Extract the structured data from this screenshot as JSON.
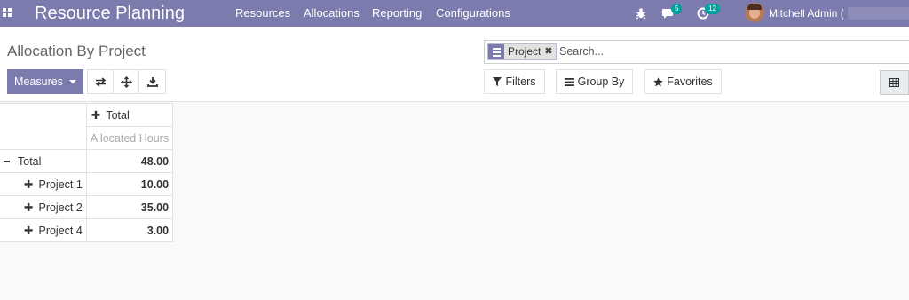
{
  "navbar": {
    "brand": "Resource Planning",
    "menu": [
      "Resources",
      "Allocations",
      "Reporting",
      "Configurations"
    ],
    "chat_count": "5",
    "activity_count": "12",
    "user_name": "Mitchell Admin ("
  },
  "breadcrumb": "Allocation By Project",
  "search": {
    "facet_label": "Project",
    "facet_remove": "✖",
    "placeholder": "Search..."
  },
  "buttons": {
    "measures": "Measures",
    "filters": "Filters",
    "group_by": "Group By",
    "favorites": "Favorites"
  },
  "pivot": {
    "column_header": "Total",
    "measure": "Allocated Hours",
    "total_label": "Total",
    "total_value": "48.00",
    "rows": [
      {
        "label": "Project 1",
        "value": "10.00"
      },
      {
        "label": "Project 2",
        "value": "35.00"
      },
      {
        "label": "Project 4",
        "value": "3.00"
      }
    ]
  }
}
